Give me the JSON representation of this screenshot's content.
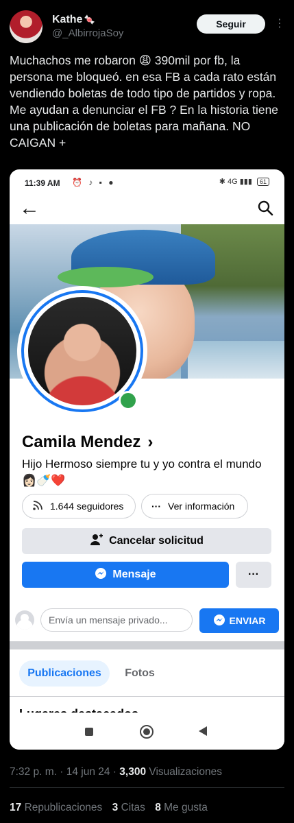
{
  "tweet": {
    "author_name": "Kathe",
    "author_emoji": "🍬",
    "handle": "@_AlbirrojaSoy",
    "follow_label": "Seguir",
    "more_icon": "more-dots-icon",
    "text": "Muchachos me robaron 😩 390mil por fb, la persona me bloqueó. en esa FB a cada rato están vendiendo boletas de todo tipo de partidos y ropa. Me ayudan a denunciar el FB ?  En la historia tiene una publicación de boletas para mañana. NO CAIGAN +",
    "time": "7:32 p. m.",
    "date": "14 jun 24",
    "views_count": "3,300",
    "views_label": "Visualizaciones",
    "reposts_count": "17",
    "reposts_label": "Republicaciones",
    "quotes_count": "3",
    "quotes_label": "Citas",
    "likes_count": "8",
    "likes_label": "Me gusta"
  },
  "phone": {
    "status_time": "11:39 AM",
    "status_icons": "⏰ ♪ ▪ ●",
    "signal": "✱ 4G ▮▮▮",
    "battery": "61",
    "profile": {
      "name": "Camila Mendez",
      "chevron": "›",
      "bio": "Hijo Hermoso siempre tu y yo contra el mundo 👩🏻🍼❤️",
      "followers": "1.644 seguidores",
      "info": "Ver información",
      "cancel_request": "Cancelar solicitud",
      "message": "Mensaje",
      "more": "···",
      "private_msg_placeholder": "Envía un mensaje privado...",
      "send": "ENVIAR",
      "tabs": [
        {
          "label": "Publicaciones",
          "active": true
        },
        {
          "label": "Fotos",
          "active": false
        }
      ],
      "cut_heading": "Lugares destacados"
    }
  },
  "colors": {
    "fb_blue": "#1877f2",
    "online_green": "#31a24c",
    "twitter_text": "#e7e9ea",
    "twitter_muted": "#71767b"
  }
}
